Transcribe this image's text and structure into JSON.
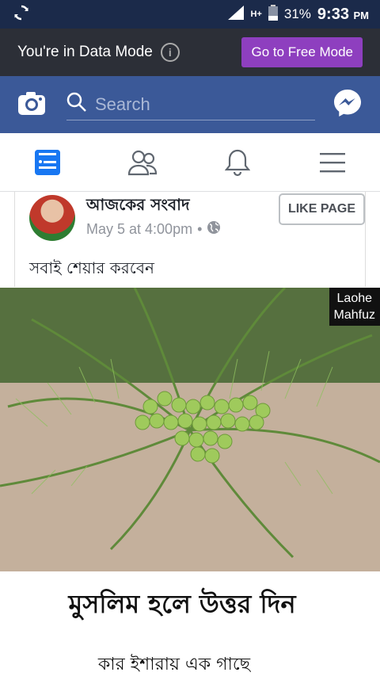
{
  "status_bar": {
    "battery": "31%",
    "time": "9:33",
    "ampm": "PM",
    "network": "H+"
  },
  "data_banner": {
    "message": "You're in Data Mode",
    "info": "i",
    "button": "Go to Free Mode"
  },
  "header": {
    "search_placeholder": "Search"
  },
  "post": {
    "page_name": "আজকের সংবাদ",
    "date": "May 5 at 4:00pm",
    "separator": "•",
    "like_button": "LIKE PAGE",
    "text": "সবাই শেয়ার করবেন",
    "watermark_line1": "Laohe",
    "watermark_line2": "Mahfuz",
    "caption_line1": "মুসলিম হলে উত্তর দিন",
    "caption_line2": "কার ইশারায় এক গাছে"
  }
}
